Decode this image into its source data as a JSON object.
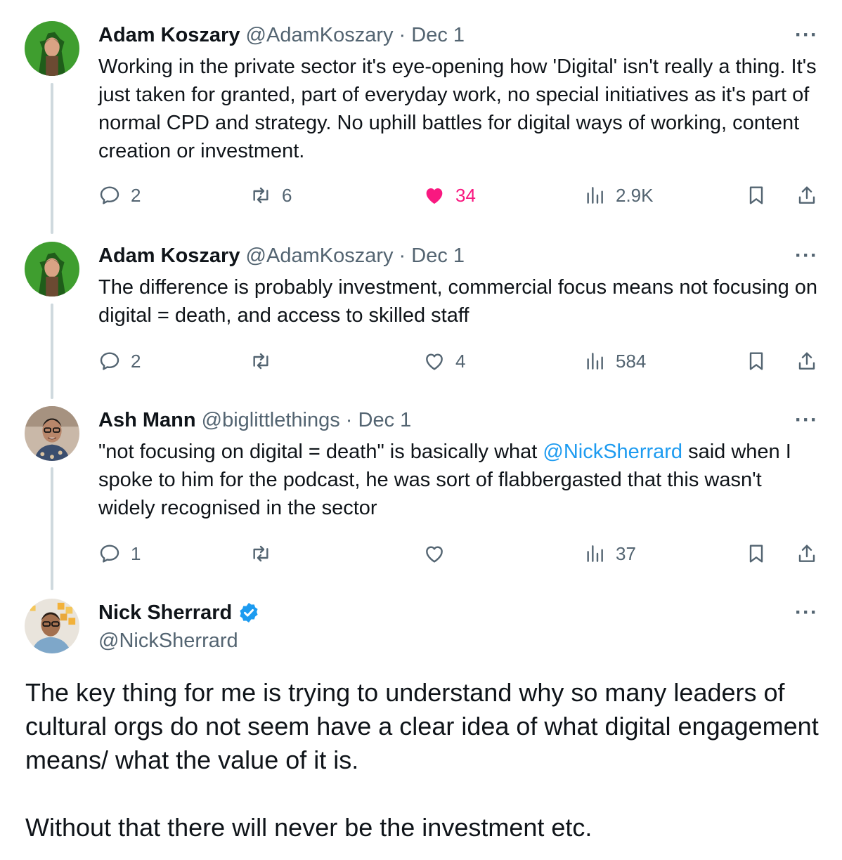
{
  "tweets": [
    {
      "name": "Adam Koszary",
      "handle": "@AdamKoszary",
      "separator": "·",
      "date": "Dec 1",
      "more": "···",
      "text": "Working in the private sector it's eye-opening how 'Digital' isn't really a thing. It's just taken for granted, part of everyday work, no special initiatives as it's part of normal CPD and strategy. No uphill battles for digital ways of working, content creation or investment.",
      "replies": "2",
      "reposts": "6",
      "likes": "34",
      "views": "2.9K"
    },
    {
      "name": "Adam Koszary",
      "handle": "@AdamKoszary",
      "separator": "·",
      "date": "Dec 1",
      "more": "···",
      "text": "The difference is probably investment, commercial focus means not focusing on digital = death, and access to skilled staff",
      "replies": "2",
      "reposts": "",
      "likes": "4",
      "views": "584"
    },
    {
      "name": "Ash Mann",
      "handle": "@biglittlethings",
      "separator": "·",
      "date": "Dec 1",
      "more": "···",
      "text_before": "\"not focusing on digital = death\" is basically what ",
      "mention": "@NickSherrard",
      "text_after": " said when I spoke to him for the podcast, he was sort of flabbergasted that this wasn't widely recognised in the sector",
      "replies": "1",
      "reposts": "",
      "likes": "",
      "views": "37"
    }
  ],
  "main_tweet": {
    "name": "Nick Sherrard",
    "handle": "@NickSherrard",
    "more": "···",
    "paragraph1": "The key thing for me is trying to understand why so many leaders of cultural orgs do not seem have a clear idea of what digital engagement means/ what the value of it is.",
    "paragraph2": "Without that there will never be the investment etc."
  },
  "colors": {
    "text": "#0f1419",
    "secondary": "#536471",
    "accent": "#1d9bf0",
    "like": "#f91880",
    "thread_line": "#cfd9de"
  },
  "icons": [
    "reply-icon",
    "repost-icon",
    "like-icon",
    "views-icon",
    "bookmark-icon",
    "share-icon",
    "verified-badge-icon",
    "more-icon"
  ]
}
